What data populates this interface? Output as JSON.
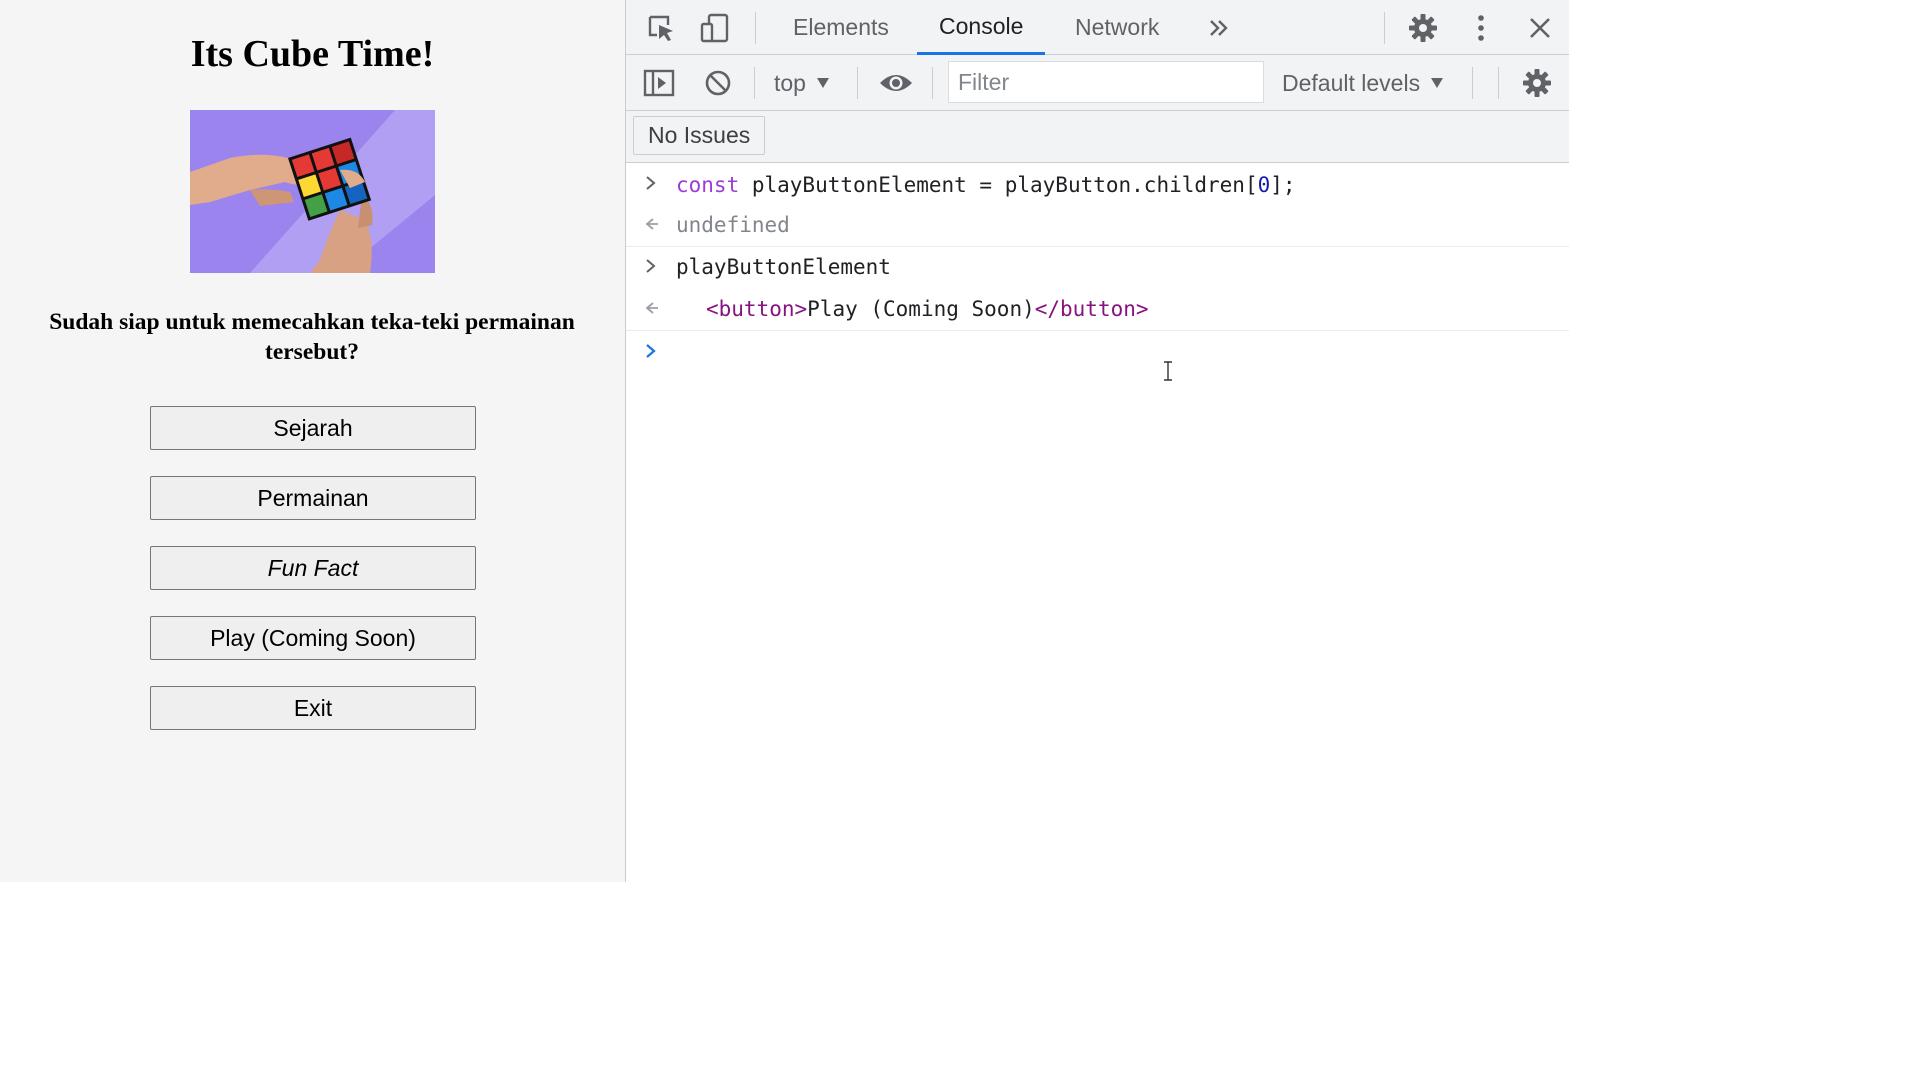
{
  "page": {
    "title": "Its Cube Time!",
    "question": "Sudah siap untuk memecahkan teka-teki permainan tersebut?",
    "buttons": [
      {
        "label": "Sejarah"
      },
      {
        "label": "Permainan"
      },
      {
        "label": "Fun Fact"
      },
      {
        "label": "Play (Coming Soon)"
      },
      {
        "label": "Exit"
      }
    ]
  },
  "devtools": {
    "tabs": [
      {
        "label": "Elements"
      },
      {
        "label": "Console"
      },
      {
        "label": "Network"
      }
    ],
    "active_tab": "Console",
    "toolbar": {
      "context": "top",
      "filter_placeholder": "Filter",
      "levels": "Default levels"
    },
    "issues_label": "No Issues",
    "console": {
      "line1": {
        "kw": "const",
        "rest": " playButtonElement = playButton.children[",
        "num": "0",
        "end": "];"
      },
      "line2": "undefined",
      "line3": "playButtonElement",
      "line4": {
        "open": "<button>",
        "text": "Play (Coming Soon)",
        "close": "</button>"
      }
    }
  },
  "colors": {
    "accent": "#1a73e8",
    "keyword": "#9c3cd8",
    "tag": "#881280",
    "number": "#1a1aa6"
  }
}
